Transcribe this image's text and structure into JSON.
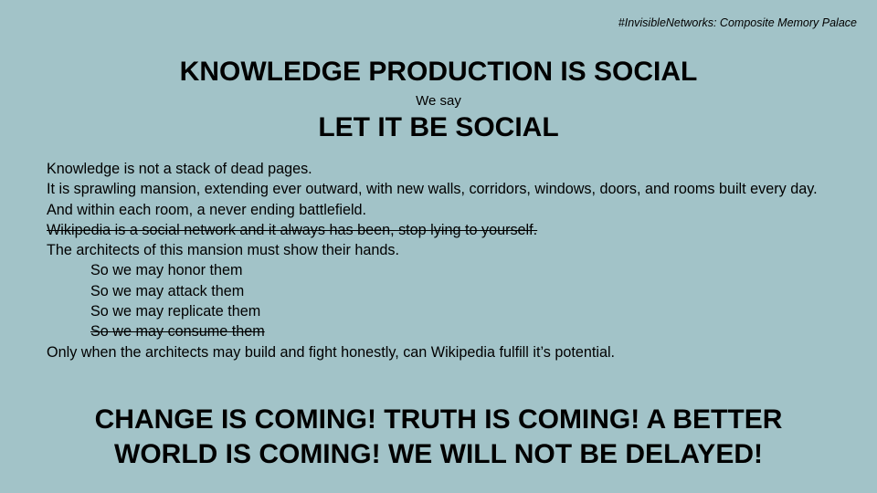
{
  "slide": {
    "tag": "#InvisibleNetworks: Composite Memory Palace",
    "title": "KNOWLEDGE PRODUCTION IS SOCIAL",
    "subtitle": "We say",
    "title2": "LET IT BE SOCIAL",
    "lines": {
      "l1": "Knowledge is not a stack of dead pages.",
      "l2": "It is sprawling mansion, extending ever outward, with new walls, corridors, windows, doors, and rooms built every day.",
      "l3": "And within each room, a never ending battlefield.",
      "l4": "Wikipedia is a social network and it always has been, stop lying to yourself.",
      "l5": "The architects of this mansion must show their hands.",
      "i1": "So we may honor them",
      "i2": "So we may attack them",
      "i3": "So we may replicate them",
      "i4": "So we may consume them",
      "l6": "Only when the architects may build and fight honestly, can Wikipedia fulfill it’s potential."
    },
    "footer_line1": "CHANGE IS COMING! TRUTH IS COMING! A BETTER",
    "footer_line2": "WORLD IS COMING! WE WILL NOT BE DELAYED!"
  },
  "colors": {
    "background": "#a2c3c8",
    "text": "#000000"
  }
}
